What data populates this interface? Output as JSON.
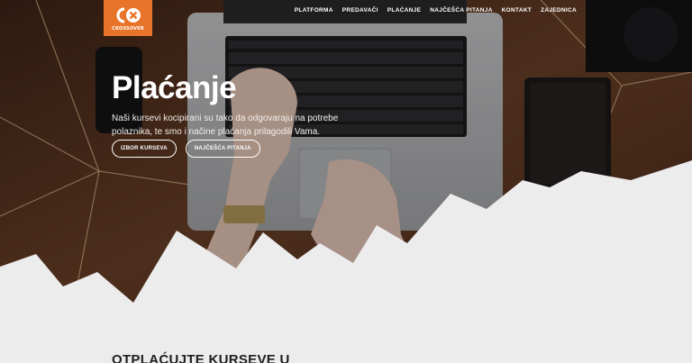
{
  "brand": {
    "logo_text": "CROSSOVER"
  },
  "nav": {
    "items": [
      {
        "label": "PLATFORMA"
      },
      {
        "label": "PREDAVAČI"
      },
      {
        "label": "PLAĆANJE"
      },
      {
        "label": "NAJČEŠĆA PITANJA"
      },
      {
        "label": "KONTAKT"
      },
      {
        "label": "ZAJEDNICA"
      }
    ]
  },
  "hero": {
    "title": "Plaćanje",
    "subtitle": "Naši kursevi kocipirani su tako da odgovaraju na potrebe polaznika, te smo i načine plaćanja prilagodili Vama.",
    "buttons": [
      {
        "label": "IZBOR KURSEVA"
      },
      {
        "label": "NAJČEŠĆA PITANJA"
      }
    ]
  },
  "section": {
    "title": "OTPLAĆUJTE KURSEVE U"
  },
  "colors": {
    "brand_orange": "#e8742a",
    "page_bg": "#ececed",
    "wood": "#5a3520"
  }
}
